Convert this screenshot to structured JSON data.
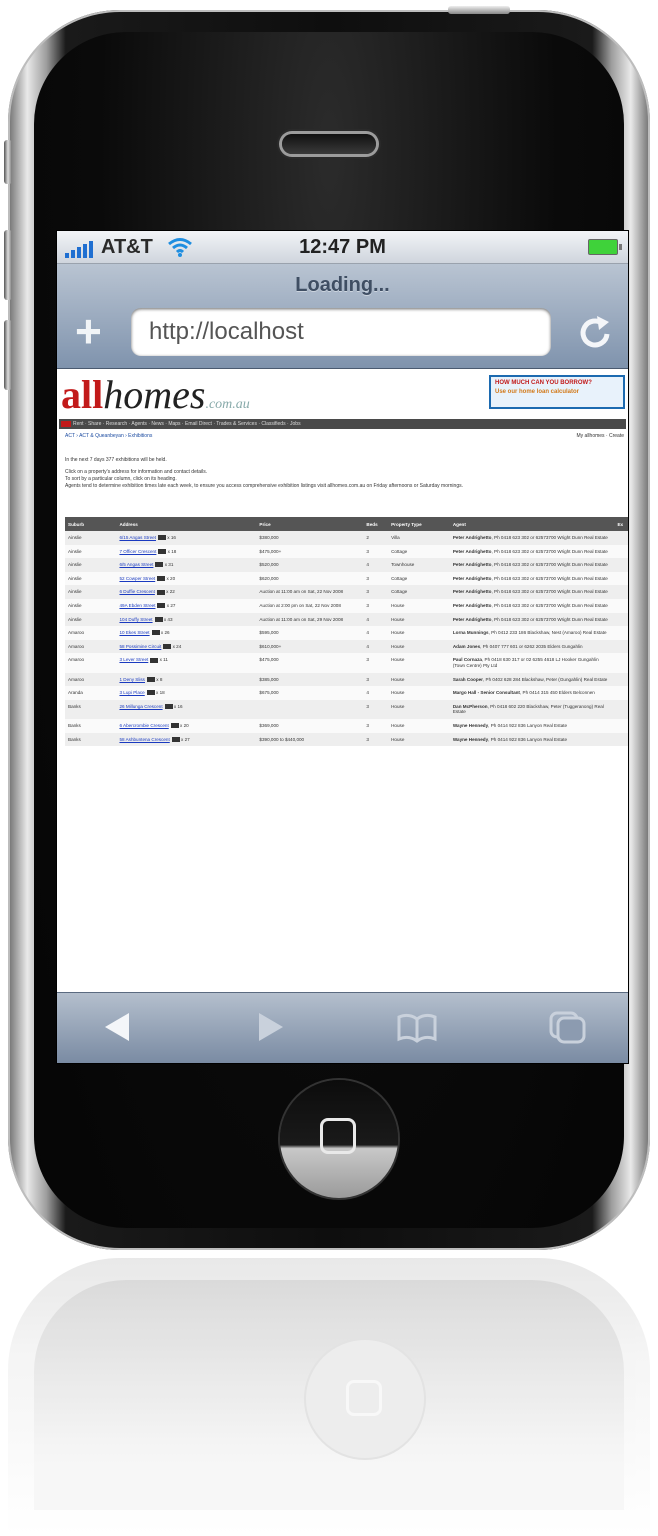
{
  "status_bar": {
    "carrier": "AT&T",
    "time": "12:47 PM"
  },
  "browser": {
    "title": "Loading...",
    "url": "http://localhost"
  },
  "site": {
    "logo_all": "all",
    "logo_homes": "homes",
    "logo_domain": ".com.au",
    "ad_line1": "HOW MUCH CAN YOU BORROW?",
    "ad_line2": "Use our home loan calculator",
    "menu": "Rent · Share · Research · Agents · News · Maps · Email Direct · Trades & Services · Classifieds · Jobs",
    "breadcrumb": "ACT › ACT & Queanbeyan › Exhibitions",
    "my_allhomes": "My allhomes · Create",
    "intro": [
      "In the next 7 days 377 exhibitions will be held.",
      "Click on a property's address for information and contact details.",
      "To sort by a particular column, click on its heading.",
      "Agents tend to determine exhibition times late each week, to ensure you access comprehensive exhibition listings visit allhomes.com.au on Friday afternoons or Saturday mornings."
    ]
  },
  "table": {
    "headers": [
      "Suburb",
      "Address",
      "Price",
      "Beds",
      "Property Type",
      "Agent",
      "Ex"
    ],
    "rows": [
      {
        "suburb": "Ainslie",
        "address": "6/15 Angas Street",
        "photos": "x 16",
        "price": "$380,000",
        "beds": "2",
        "type": "Villa",
        "agent": "Peter Andrighetto",
        "agent_rest": ", Ph 0418 623 302 or 62573700 Wright Dunn Real Estate"
      },
      {
        "suburb": "Ainslie",
        "address": "7 Officer Crescent",
        "photos": "x 18",
        "price": "$475,000+",
        "beds": "3",
        "type": "Cottage",
        "agent": "Peter Andrighetto",
        "agent_rest": ", Ph 0418 623 302 or 62573700 Wright Dunn Real Estate"
      },
      {
        "suburb": "Ainslie",
        "address": "6/5 Angas Street",
        "photos": "x 31",
        "price": "$520,000",
        "beds": "4",
        "type": "Townhouse",
        "agent": "Peter Andrighetto",
        "agent_rest": ", Ph 0418 623 302 or 62573700 Wright Dunn Real Estate"
      },
      {
        "suburb": "Ainslie",
        "address": "52 Cowper Street",
        "photos": "x 20",
        "price": "$620,000",
        "beds": "3",
        "type": "Cottage",
        "agent": "Peter Andrighetto",
        "agent_rest": ", Ph 0418 623 302 or 62573700 Wright Dunn Real Estate"
      },
      {
        "suburb": "Ainslie",
        "address": "6 Duffie Crescent",
        "photos": "x 22",
        "price": "Auction at 11:00 am on Sat, 22 Nov 2008",
        "beds": "3",
        "type": "Cottage",
        "agent": "Peter Andrighetto",
        "agent_rest": ", Ph 0418 623 302 or 62573700 Wright Dunn Real Estate"
      },
      {
        "suburb": "Ainslie",
        "address": "49A Ebden Street",
        "photos": "x 27",
        "price": "Auction at 2:00 pm on Sat, 22 Nov 2008",
        "beds": "3",
        "type": "House",
        "agent": "Peter Andrighetto",
        "agent_rest": ", Ph 0418 623 302 or 62573700 Wright Dunn Real Estate"
      },
      {
        "suburb": "Ainslie",
        "address": "104 Duffy Street",
        "photos": "x 43",
        "price": "Auction at 11:00 am on Sat, 29 Nov 2008",
        "beds": "4",
        "type": "House",
        "agent": "Peter Andrighetto",
        "agent_rest": ", Ph 0418 623 302 or 62573700 Wright Dunn Real Estate"
      },
      {
        "suburb": "Amaroo",
        "address": "10 Ekes Street",
        "photos": "x 26",
        "price": "$595,000",
        "beds": "4",
        "type": "House",
        "agent": "Lorna Munnings",
        "agent_rest": ", Ph 0412 233 186 Blackshaw, Nest (Amaroo) Real Estate"
      },
      {
        "suburb": "Amaroo",
        "address": "58 Possimine Circuit",
        "photos": "x 24",
        "price": "$610,000+",
        "beds": "4",
        "type": "House",
        "agent": "Adam Jones",
        "agent_rest": ", Ph 0407 777 601 or 6262 2035 Elders Gungahlin"
      },
      {
        "suburb": "Amaroo",
        "address": "3 Lever Street",
        "photos": "x 11",
        "price": "$475,000",
        "beds": "3",
        "type": "House",
        "agent": "Paul Cornaza",
        "agent_rest": ", Ph 0418 630 317 or 02 6255 4618 LJ Hooker Gungahlin (Town Centre) Pty Ltd"
      },
      {
        "suburb": "Amaroo",
        "address": "1 Deny Sliss",
        "photos": "x 8",
        "price": "$385,000",
        "beds": "3",
        "type": "House",
        "agent": "Sarah Cooper",
        "agent_rest": ", Ph 0402 628 284 Blackshaw, Peter (Gungahlin) Real Estate"
      },
      {
        "suburb": "Aranda",
        "address": "3 Lupi Place",
        "photos": "x 18",
        "price": "$675,000",
        "beds": "4",
        "type": "House",
        "agent": "Margo Hall - Senior Consultant",
        "agent_rest": ", Ph 0414 315 450 Elders Belconnen"
      },
      {
        "suburb": "Banks",
        "address": "26 Millunga Crescent",
        "photos": "x 16",
        "price": "",
        "beds": "3",
        "type": "House",
        "agent": "Dan McPherson",
        "agent_rest": ", Ph 0418 602 220 Blackshaw, Peter (Tuggeranong) Real Estate"
      },
      {
        "suburb": "Banks",
        "address": "6 Abercrombie Crescent",
        "photos": "x 20",
        "price": "$369,000",
        "beds": "3",
        "type": "House",
        "agent": "Wayne Hennedy",
        "agent_rest": ", Ph 0414 922 836 Lanyon Real Estate"
      },
      {
        "suburb": "Banks",
        "address": "58 Ashbuntena Crescent",
        "photos": "x 27",
        "price": "$390,000 to $440,000",
        "beds": "3",
        "type": "House",
        "agent": "Wayne Hennedy",
        "agent_rest": ", Ph 0414 922 836 Lanyon Real Estate"
      }
    ]
  },
  "colors": {
    "status_bar_top": "#f2f4f7",
    "nav_bar": "#8a9cb5",
    "toolbar": "#9aa8ba",
    "logo_red": "#c21a1a",
    "link": "#1a3ac0"
  },
  "icons": {
    "back": "back-arrow-icon",
    "forward": "forward-arrow-icon",
    "bookmarks": "bookmarks-book-icon",
    "pages": "pages-icon",
    "reload": "reload-icon",
    "add": "plus-icon"
  }
}
